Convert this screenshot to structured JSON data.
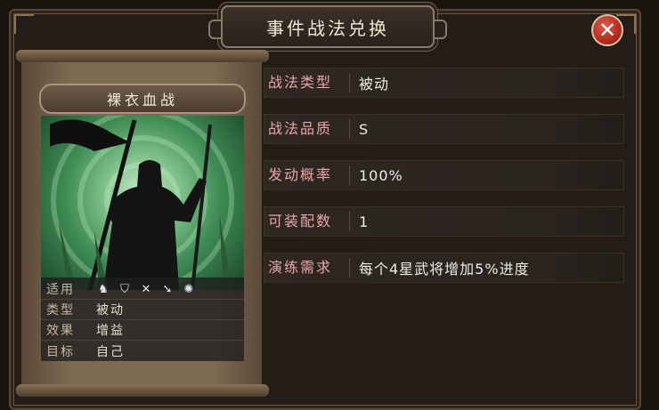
{
  "header": {
    "title": "事件战法兑换",
    "close_icon": "close-x-icon"
  },
  "card": {
    "name": "裸衣血战",
    "info": {
      "suit_label": "适用",
      "suit_icons": [
        "cavalry-icon",
        "shield-icon",
        "archer-icon",
        "spear-icon",
        "chariot-icon"
      ],
      "type_label": "类型",
      "type_value": "被动",
      "effect_label": "效果",
      "effect_value": "增益",
      "target_label": "目标",
      "target_value": "自己"
    }
  },
  "details": [
    {
      "label": "战法类型",
      "value": "被动"
    },
    {
      "label": "战法品质",
      "value": "S"
    },
    {
      "label": "发动概率",
      "value": "100%"
    },
    {
      "label": "可装配数",
      "value": "1"
    },
    {
      "label": "演练需求",
      "value": "每个4星武将增加5%进度"
    }
  ],
  "colors": {
    "label_pink": "#e9a6a6",
    "close_red": "#b0281d",
    "art_green": "#3f8d55"
  }
}
